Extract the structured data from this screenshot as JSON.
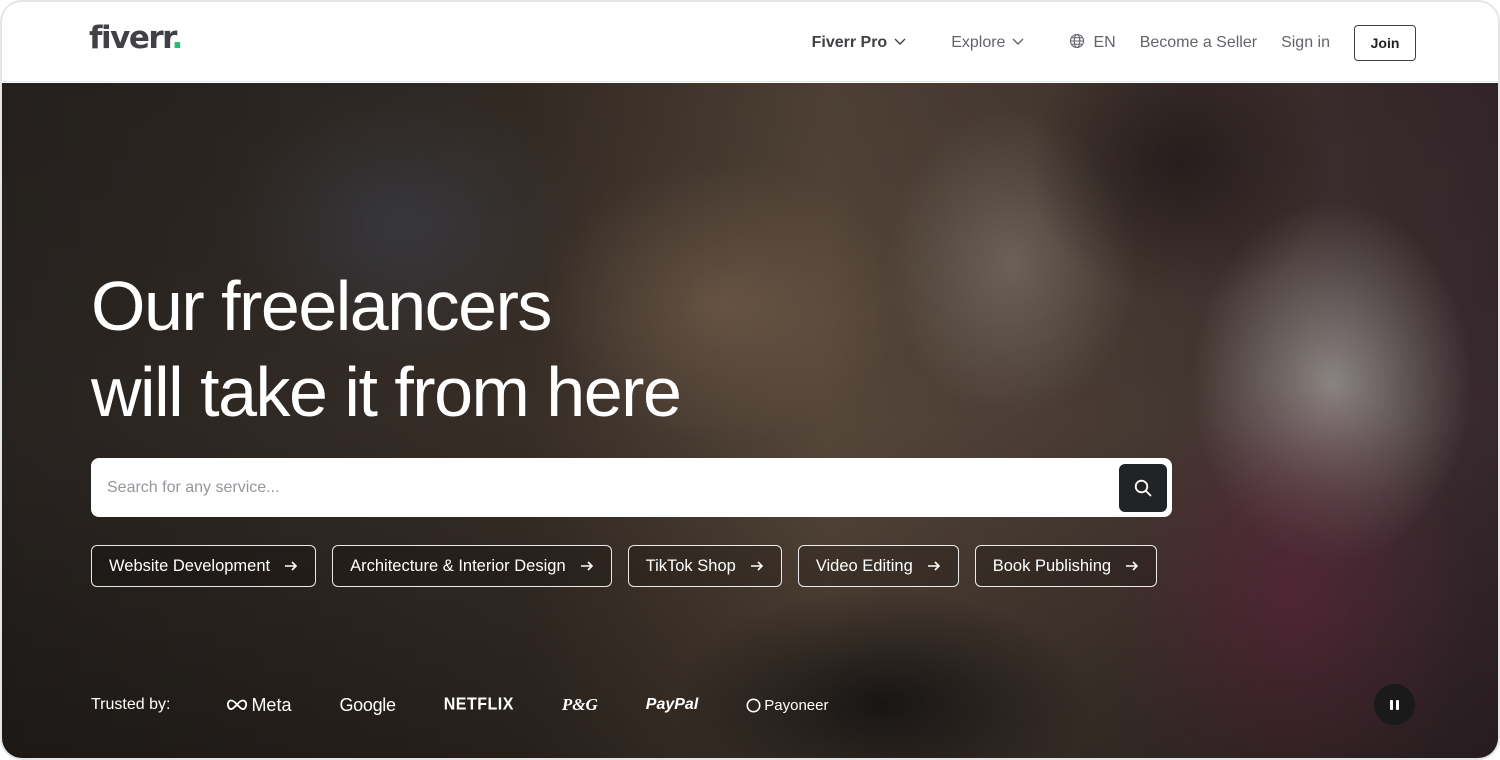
{
  "header": {
    "logo_text": "fiverr",
    "logo_dot": ".",
    "nav": {
      "fiverr_pro": "Fiverr Pro",
      "explore": "Explore",
      "language": "EN",
      "become_seller": "Become a Seller",
      "sign_in": "Sign in",
      "join": "Join"
    }
  },
  "hero": {
    "headline_line1": "Our freelancers",
    "headline_line2": "will take it from here",
    "search": {
      "placeholder": "Search for any service..."
    },
    "chips": [
      {
        "label": "Website Development"
      },
      {
        "label": "Architecture & Interior Design"
      },
      {
        "label": "TikTok Shop"
      },
      {
        "label": "Video Editing"
      },
      {
        "label": "Book Publishing"
      }
    ],
    "trusted_by": {
      "label": "Trusted by:",
      "brands": [
        "Meta",
        "Google",
        "NETFLIX",
        "P&G",
        "PayPal",
        "Payoneer"
      ]
    }
  },
  "colors": {
    "brand_green": "#1dbf73",
    "text_dark": "#404145",
    "text_muted": "#62646a",
    "search_button": "#222325"
  },
  "icons": {
    "explore_chevron": "chevron-down-icon",
    "language": "globe-icon",
    "search": "search-icon",
    "chip_arrow": "arrow-right-icon",
    "media_control": "pause-icon"
  }
}
